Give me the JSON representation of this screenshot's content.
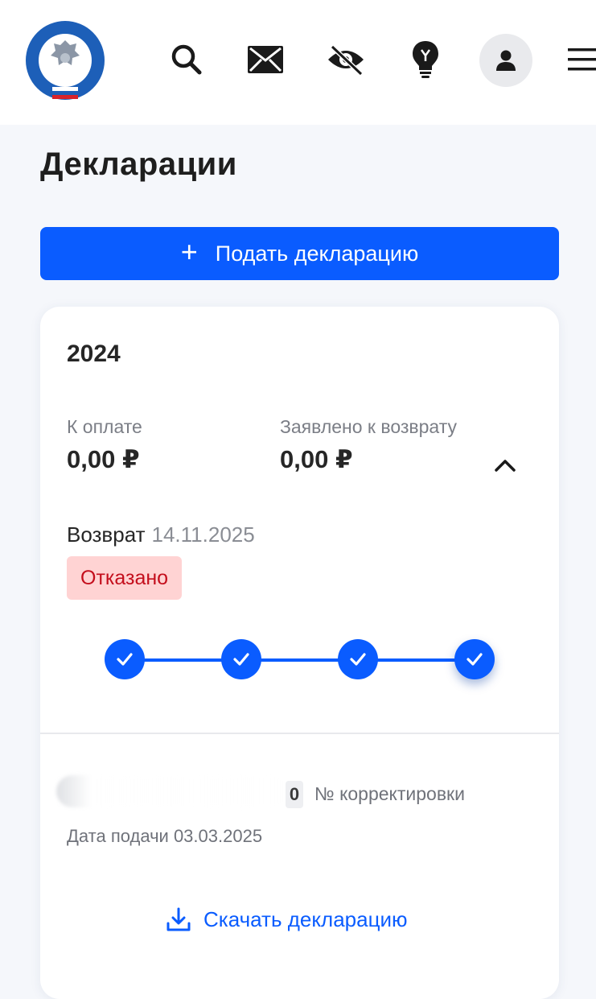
{
  "header": {
    "logo_text": "ФЕДЕРАЛЬНАЯ НАЛОГОВАЯ СЛУЖБА",
    "icons": [
      "fns-emblem-icon",
      "search-icon",
      "mail-icon",
      "hide-eye-icon",
      "lightbulb-icon",
      "profile-icon",
      "menu-icon"
    ]
  },
  "page": {
    "title": "Декларации",
    "submit_button": "Подать декларацию"
  },
  "card": {
    "year": "2024",
    "to_pay_label": "К оплате",
    "to_pay_value": "0,00 ₽",
    "declared_refund_label": "Заявлено к возврату",
    "declared_refund_value": "0,00 ₽",
    "refund_label": "Возврат",
    "refund_date": "14.11.2025",
    "status": "Отказано",
    "progress_steps_completed": 4,
    "progress_steps_total": 4,
    "correction_number": "0",
    "correction_label": "№ корректировки",
    "filed_date": "Дата подачи 03.03.2025",
    "download_label": "Скачать декларацию"
  },
  "colors": {
    "accent": "#0a5cff",
    "status_bg": "#ffd3d3",
    "status_text": "#c40e1c"
  }
}
